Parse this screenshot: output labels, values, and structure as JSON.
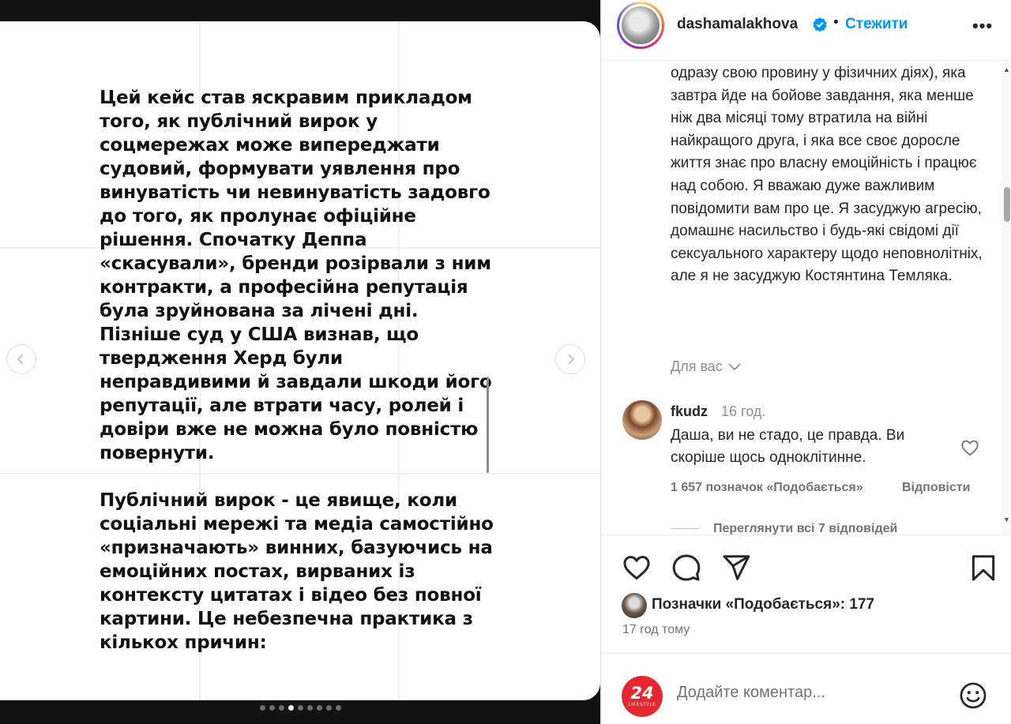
{
  "slide": {
    "paragraphs": [
      "Цей кейс став яскравим прикладом того, як публічний вирок у соцмережах може випереджати судовий, формувати уявлення про винуватість чи невинуватість задовго до того, як пролунає офіційне рішення. Спочатку Деппа «скасували», бренди розірвали з ним контракти, а професійна репутація була зруйнована за лічені дні. Пізніше суд у США визнав, що твердження Херд були неправдивими й завдали шкоди його репутації, але втрати часу, ролей і довіри вже не можна було повністю повернути.",
      "Публічний вирок - це явище, коли соціальні мережі та медіа самостійно «призначають» винних, базуючись на емоційних постах, вирваних із контексту цитатах і відео без повної картини. Це небезпечна практика з кількох причин:"
    ],
    "dot_count": 9,
    "active_dot": 3,
    "prev_icon": "chevron-left-icon",
    "next_icon": "chevron-right-icon"
  },
  "header": {
    "username": "dashamalakhova",
    "separator": "•",
    "follow_label": "Стежити",
    "more_icon": "•••",
    "verified_color": "#0095f6"
  },
  "caption": {
    "text": "одразу свою провину у фізичних діях), яка завтра йде на бойове завдання, яка менше ніж два місяці тому втратила на війні найкращого друга, і яка все своє доросле життя знає про власну емоційність і працює над собою. Я вважаю дуже важливим повідомити вам про це. Я засуджую агресію, домашнє насильство і будь-які свідомі дії сексуального характеру щодо неповнолітніх, але я не засуджую Костянтина Темляка."
  },
  "for_you": {
    "label": "Для вас"
  },
  "comment": {
    "user": "fkudz",
    "time": "16 год.",
    "text": "Даша, ви не стадо, це правда. Ви скоріше щось одноклітинне.",
    "likes": "1 657 позначок «Подобається»",
    "reply_label": "Відповісти",
    "view_replies": "Переглянути всі 7 відповідей"
  },
  "actions": {
    "likes_summary": "Позначки «Подобається»: 177",
    "post_time": "17 год тому"
  },
  "add_comment": {
    "placeholder": "Додайте коментар...",
    "avatar_number": "24",
    "avatar_label": "LIFESTYLE",
    "brand_color": "#e5282f"
  },
  "colors": {
    "accent": "#0095f6",
    "muted": "#737373",
    "text": "#262626"
  }
}
